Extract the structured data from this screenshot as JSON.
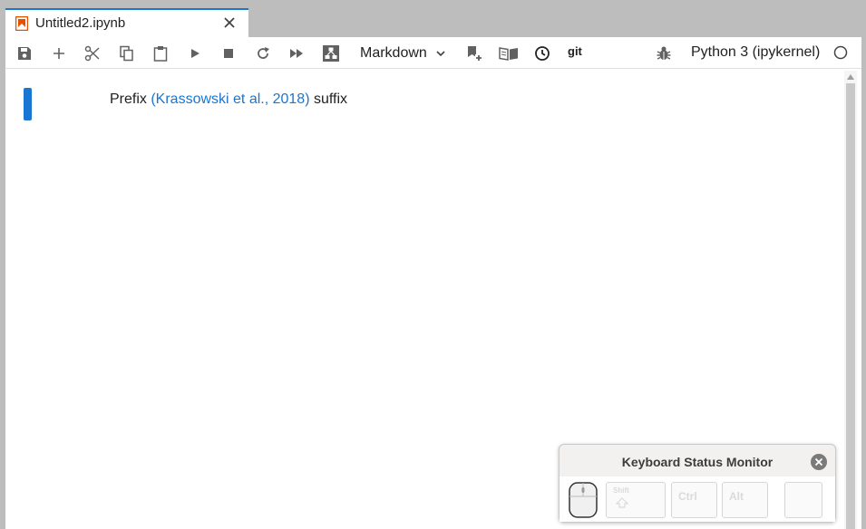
{
  "tab": {
    "title": "Untitled2.ipynb",
    "icon": "notebook-icon",
    "close_icon": "close-icon"
  },
  "toolbar": {
    "buttons": [
      {
        "name": "save",
        "icon": "save-icon"
      },
      {
        "name": "insert-cell",
        "icon": "plus-icon"
      },
      {
        "name": "cut",
        "icon": "scissors-icon"
      },
      {
        "name": "copy",
        "icon": "copy-icon"
      },
      {
        "name": "paste",
        "icon": "paste-icon"
      },
      {
        "name": "run",
        "icon": "play-icon"
      },
      {
        "name": "interrupt",
        "icon": "stop-icon"
      },
      {
        "name": "restart",
        "icon": "refresh-icon"
      },
      {
        "name": "restart-run-all",
        "icon": "fast-forward-icon"
      },
      {
        "name": "diagram",
        "icon": "diagram-icon"
      },
      {
        "name": "add-citation",
        "icon": "bookmark-plus-icon"
      },
      {
        "name": "bibliography",
        "icon": "book-icon"
      },
      {
        "name": "history",
        "icon": "clock-icon"
      },
      {
        "name": "debugger",
        "icon": "bug-icon"
      }
    ],
    "cell_type": "Markdown",
    "git_label": "git",
    "kernel_name": "Python 3 (ipykernel)",
    "kernel_status_icon": "circle-idle-icon"
  },
  "cell": {
    "prefix": "Prefix ",
    "citation": "(Krassowski et al., 2018)",
    "suffix": " suffix"
  },
  "keyboard_monitor": {
    "title": "Keyboard Status Monitor",
    "keys": {
      "shift": "Shift",
      "ctrl": "Ctrl",
      "alt": "Alt"
    }
  },
  "colors": {
    "accent": "#1976d2",
    "text": "#212121"
  }
}
